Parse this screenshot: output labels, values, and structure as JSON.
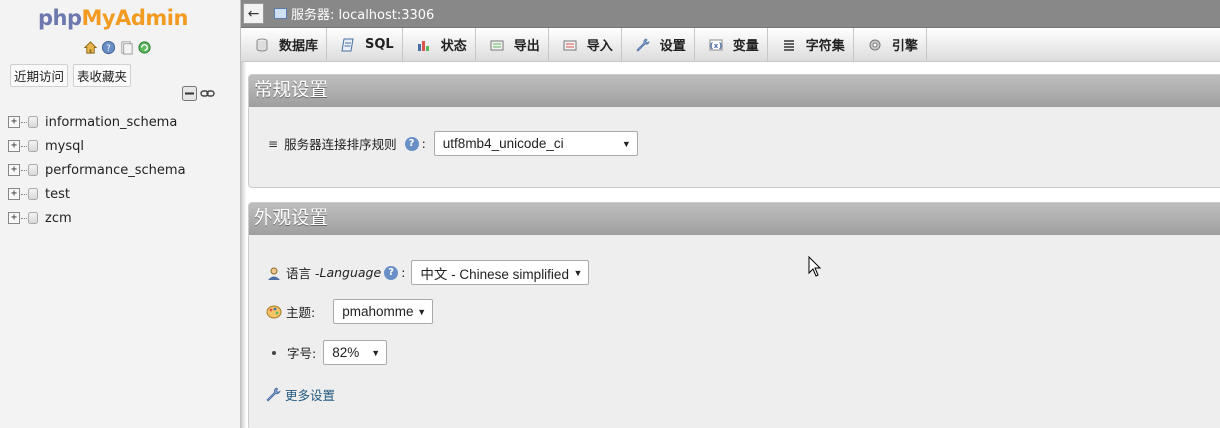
{
  "nav": {
    "logo_part1": "php",
    "logo_part2": "MyAdmin",
    "tabs": [
      "近期访问",
      "表收藏夹"
    ],
    "databases": [
      "information_schema",
      "mysql",
      "performance_schema",
      "test",
      "zcm"
    ]
  },
  "serverbar": {
    "title": "服务器: localhost:3306"
  },
  "menu": {
    "tabs": [
      {
        "label": "数据库",
        "icon": "database-icon"
      },
      {
        "label": "SQL",
        "icon": "sql-icon"
      },
      {
        "label": "状态",
        "icon": "status-icon"
      },
      {
        "label": "导出",
        "icon": "export-icon"
      },
      {
        "label": "导入",
        "icon": "import-icon"
      },
      {
        "label": "设置",
        "icon": "wrench-icon"
      },
      {
        "label": "变量",
        "icon": "variables-icon"
      },
      {
        "label": "字符集",
        "icon": "charset-icon"
      },
      {
        "label": "引擎",
        "icon": "engine-icon"
      }
    ]
  },
  "general": {
    "heading": "常规设置",
    "collation_label": "服务器连接排序规则",
    "collation_value": "utf8mb4_unicode_ci"
  },
  "appearance": {
    "heading": "外观设置",
    "language_label": "语言 - ",
    "language_label_italic": "Language",
    "language_value": "中文 - Chinese simplified",
    "theme_label": "主题:",
    "theme_value": "pmahomme",
    "fontsize_label": "字号:",
    "fontsize_value": "82%",
    "more_settings": "更多设置"
  },
  "colors": {
    "accent_link": "#235a81",
    "panel_header": "#a8a8a8",
    "serverbar": "#888888",
    "logo_php": "#6c78ae",
    "logo_myadmin": "#f29b22"
  }
}
